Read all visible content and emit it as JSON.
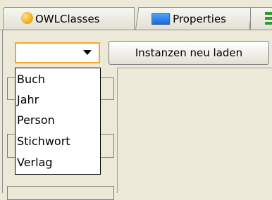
{
  "tabs": [
    {
      "label": "OWLClasses",
      "icon": "owl-classes-icon"
    },
    {
      "label": "Properties",
      "icon": "properties-icon"
    },
    {
      "label": "",
      "icon": "green-lines-icon"
    }
  ],
  "combo": {
    "value": ""
  },
  "reload_button": {
    "label": "Instanzen neu laden"
  },
  "dropdown": {
    "items": [
      "Buch",
      "Jahr",
      "Person",
      "Stichwort",
      "Verlag"
    ]
  },
  "colors": {
    "combo_focus": "#f5a623",
    "owl_icon": "#f2b020",
    "properties_icon": "#1a6ad8",
    "green_icon": "#2b9b2b"
  }
}
